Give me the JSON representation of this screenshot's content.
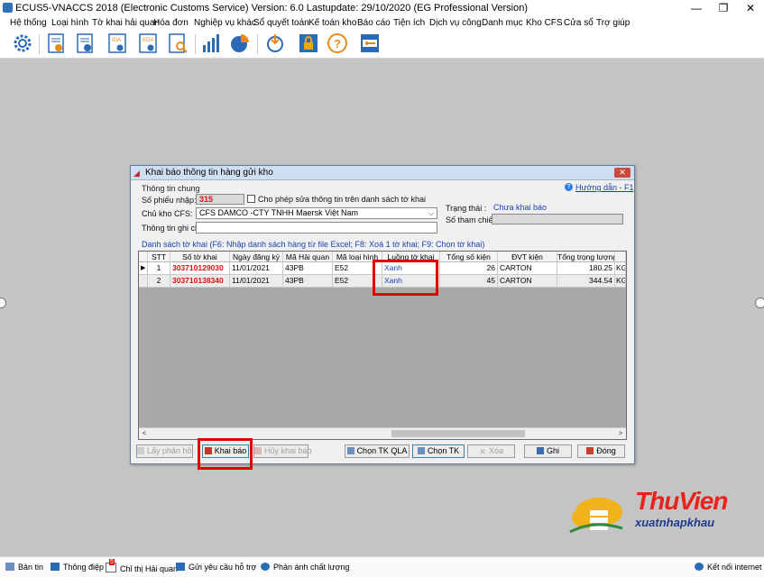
{
  "window": {
    "title": "ECUS5-VNACCS 2018 (Electronic Customs Service) Version: 6.0 Lastupdate: 29/10/2020 (EG Professional Version)",
    "minimize": "—",
    "restore": "❐",
    "close": "✕"
  },
  "menu": [
    "Hệ thống",
    "Loại hình",
    "Tờ khai hải quan",
    "Hóa đơn",
    "Nghiệp vụ khác",
    "Sổ quyết toán",
    "Kế toán kho",
    "Báo cáo",
    "Tiện ích",
    "Dịch vụ công",
    "Danh mục",
    "Kho CFS",
    "Cửa sổ",
    "Trợ giúp"
  ],
  "toolbar_icons": [
    "settings-icon",
    "import-declaration-icon",
    "export-declaration-icon",
    "ida-icon",
    "eda-icon",
    "search-document-icon",
    "bar-chart-icon",
    "pie-chart-icon",
    "sync-icon",
    "lock-icon",
    "help-icon",
    "password-icon"
  ],
  "toolbar_labels": {
    "ida": "IDA",
    "eda": "EDA"
  },
  "dialog": {
    "title": "Khai báo thông tin hàng gửi kho",
    "close": "✕",
    "group_title": "Thông tin chung",
    "help_link": "Hướng dẫn - F1",
    "so_phieu_label": "Số phiếu nhập:",
    "so_phieu_value": "315",
    "allow_edit_label": "Cho phép sửa thông tin trên danh sách tờ khai",
    "chu_kho_label": "Chủ kho CFS:",
    "chu_kho_value": "CFS DAMCO -CTY TNHH Maersk Việt Nam",
    "ghi_chu_label": "Thông tin ghi chú:",
    "ghi_chu_value": "",
    "trang_thai_label": "Trạng thái :",
    "trang_thai_value": "Chưa khai báo",
    "so_tham_chieu_label": "Số tham chiếu:",
    "so_tham_chieu_value": "",
    "list_title": "Danh sách tờ khai (F6: Nhập danh sách hàng từ file Excel; F8: Xoá 1 tờ khai; F9: Chọn tờ khai)",
    "columns": [
      "STT",
      "Số tờ khai",
      "Ngày đăng ký",
      "Mã Hải quan",
      "Mã loại hình",
      "Luồng tờ khai",
      "Tổng số kiện",
      "ĐVT kiện",
      "Tổng trọng lượng",
      ""
    ],
    "rows": [
      {
        "stt": "1",
        "so_to_khai": "303710129030",
        "ngay": "11/01/2021",
        "ma_hq": "43PB",
        "loai_hinh": "E52",
        "luong": "Xanh",
        "so_kien": "26",
        "dvt": "CARTON",
        "trong_luong": "180.25",
        "dvt_tl": "KGM"
      },
      {
        "stt": "2",
        "so_to_khai": "303710138340",
        "ngay": "11/01/2021",
        "ma_hq": "43PB",
        "loai_hinh": "E52",
        "luong": "Xanh",
        "so_kien": "45",
        "dvt": "CARTON",
        "trong_luong": "344.54",
        "dvt_tl": "KGM"
      }
    ],
    "row_indicator": "▶",
    "buttons": {
      "lay_phan_hoi": "Lấy phản hồi",
      "khai_bao": "Khai báo",
      "huy_khai_bao": "Hủy khai báo",
      "chon_tk_qla": "Chọn TK QLA",
      "chon_tk": "Chọn TK",
      "xoa": "Xóa",
      "ghi": "Ghi",
      "dong": "Đóng"
    }
  },
  "statusbar": {
    "ban_tin": "Bản tin",
    "thong_diep": "Thông điệp",
    "chi_thi": "Chỉ thị Hải quan",
    "chi_thi_badge": "5",
    "ho_tro": "Gửi yêu cầu hỗ trợ",
    "phan_anh": "Phản ánh chất lượng",
    "ket_noi": "Kết nối internet"
  },
  "watermark": {
    "line1a": "Thu",
    "line1b": "Vien",
    "line2": "xuatnhapkhau"
  },
  "colors": {
    "highlight": "#e10000",
    "red_number": "#e01010",
    "link_blue": "#1a3fb0"
  }
}
